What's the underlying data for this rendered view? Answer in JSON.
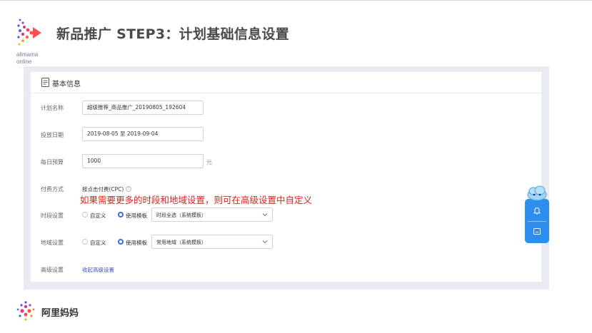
{
  "brand": {
    "logo_line1": "alimama",
    "logo_line2": "online",
    "footer_name": "阿里妈妈"
  },
  "slide": {
    "title": "新品推广 STEP3：计划基础信息设置"
  },
  "panel": {
    "title": "基本信息",
    "plan_name": {
      "label": "计划名称",
      "value": "超级推荐_商品推广_20190805_192604"
    },
    "delivery_date": {
      "label": "投放日期",
      "value": "2019-08-05 至 2019-09-04"
    },
    "daily_budget": {
      "label": "每日预算",
      "value": "1000",
      "unit": "元"
    },
    "payment": {
      "label": "付费方式",
      "value": "按点击付费(CPC)"
    },
    "time_setting": {
      "label": "时段设置",
      "option_custom": "自定义",
      "option_template": "使用模板",
      "selected": "使用模板",
      "select_value": "时段全选（系统模板）"
    },
    "region_setting": {
      "label": "地域设置",
      "option_custom": "自定义",
      "option_template": "使用模板",
      "selected": "使用模板",
      "select_value": "常用地域（系统模板）"
    },
    "advanced": {
      "label": "高级设置",
      "link": "收起高级设置"
    }
  },
  "annotation": "如果需要更多的时段和地域设置，则可在高级设置中自定义",
  "float_widget": {
    "icons": [
      "cloud-mascot-icon",
      "bell-icon",
      "message-icon"
    ]
  },
  "colors": {
    "accent_blue": "#3d6ee8",
    "link_blue": "#3d4fc8",
    "annotation_red": "#e3201c",
    "float_blue": "#2e8ef0",
    "frame_bg": "#e9ebf3"
  }
}
